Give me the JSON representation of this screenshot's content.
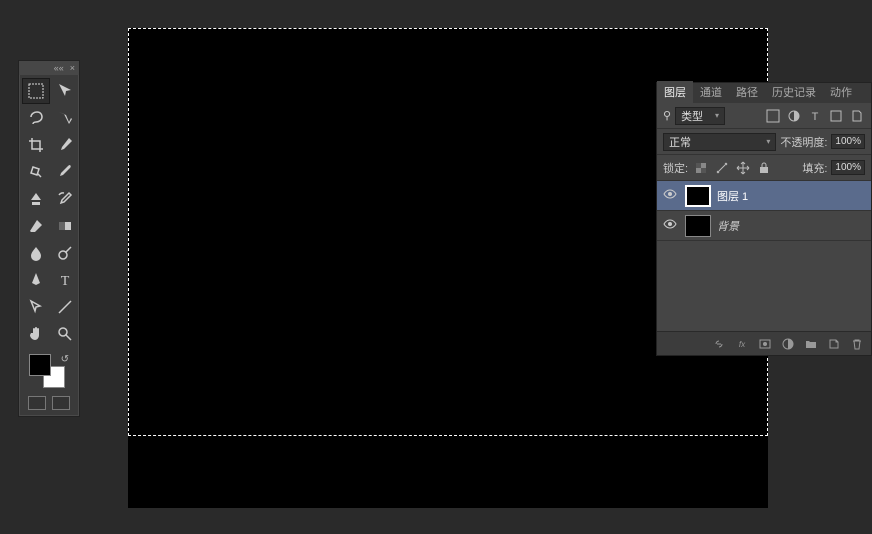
{
  "toolbox": {
    "tools": [
      {
        "name": "marquee-tool",
        "active": true
      },
      {
        "name": "move-tool"
      },
      {
        "name": "lasso-tool"
      },
      {
        "name": "quick-select-tool"
      },
      {
        "name": "crop-tool"
      },
      {
        "name": "eyedropper-tool"
      },
      {
        "name": "healing-brush-tool"
      },
      {
        "name": "brush-tool"
      },
      {
        "name": "clone-stamp-tool"
      },
      {
        "name": "history-brush-tool"
      },
      {
        "name": "eraser-tool"
      },
      {
        "name": "gradient-tool"
      },
      {
        "name": "blur-tool"
      },
      {
        "name": "dodge-tool"
      },
      {
        "name": "pen-tool"
      },
      {
        "name": "type-tool"
      },
      {
        "name": "path-select-tool"
      },
      {
        "name": "line-tool"
      },
      {
        "name": "hand-tool"
      },
      {
        "name": "zoom-tool"
      }
    ],
    "foreground_color": "#000000",
    "background_color": "#ffffff"
  },
  "panel": {
    "tabs": [
      {
        "id": "layers",
        "label": "图层",
        "active": true
      },
      {
        "id": "channels",
        "label": "通道"
      },
      {
        "id": "paths",
        "label": "路径"
      },
      {
        "id": "history",
        "label": "历史记录"
      },
      {
        "id": "actions",
        "label": "动作"
      }
    ],
    "filter_label": "类型",
    "filter_icons": [
      "image-filter",
      "adjustment-filter",
      "type-filter",
      "shape-filter",
      "smart-filter"
    ],
    "blend_mode": "正常",
    "opacity_label": "不透明度:",
    "opacity_value": "100%",
    "lock_label": "锁定:",
    "lock_icons": [
      "lock-pixels",
      "lock-position",
      "lock-move",
      "lock-all"
    ],
    "fill_label": "填充:",
    "fill_value": "100%",
    "layers": [
      {
        "name": "图层 1",
        "visible": true,
        "selected": true
      },
      {
        "name": "背景",
        "visible": true,
        "selected": false,
        "is_background": true
      }
    ],
    "footer_icons": [
      "link-icon",
      "fx-icon",
      "mask-icon",
      "adjustment-icon",
      "folder-icon",
      "new-layer-icon",
      "trash-icon"
    ]
  }
}
